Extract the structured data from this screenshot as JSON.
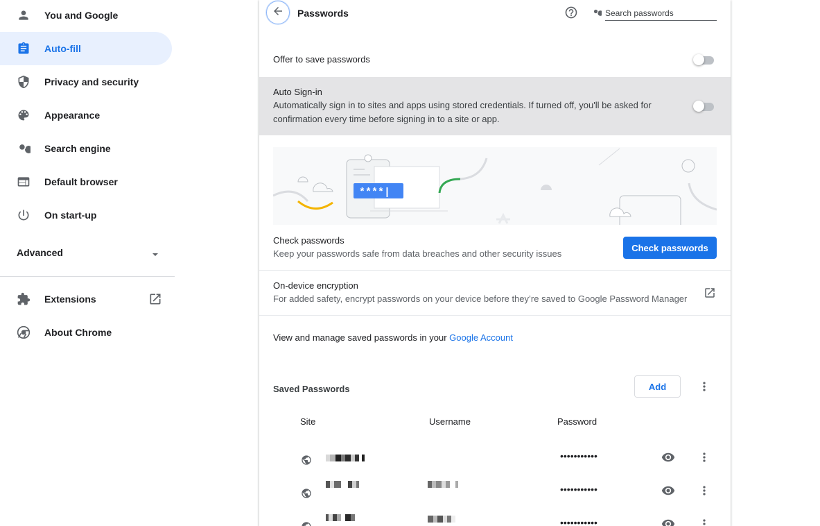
{
  "sidebar": {
    "items": [
      {
        "label": "You and Google",
        "icon": "person-icon"
      },
      {
        "label": "Auto-fill",
        "icon": "assignment-icon",
        "active": true
      },
      {
        "label": "Privacy and security",
        "icon": "shield-icon"
      },
      {
        "label": "Appearance",
        "icon": "palette-icon"
      },
      {
        "label": "Search engine",
        "icon": "search-icon"
      },
      {
        "label": "Default browser",
        "icon": "browser-window-icon"
      },
      {
        "label": "On start-up",
        "icon": "power-icon"
      }
    ],
    "advanced_label": "Advanced",
    "extensions_label": "Extensions",
    "about_label": "About Chrome"
  },
  "header": {
    "title": "Passwords",
    "search_placeholder": "Search passwords"
  },
  "settings": {
    "offer_to_save": {
      "label": "Offer to save passwords",
      "enabled": false
    },
    "auto_signin": {
      "label": "Auto Sign-in",
      "description_line1": "Automatically sign in to sites and apps using stored credentials. If turned off, you'll be asked for",
      "description_line2": "confirmation every time before signing in to a site or app.",
      "enabled": false
    },
    "check_passwords": {
      "label": "Check passwords",
      "description": "Keep your passwords safe from data breaches and other security issues",
      "button_label": "Check passwords"
    },
    "illustration_mask": "****|",
    "on_device_encryption": {
      "label": "On-device encryption",
      "description": "For added safety, encrypt passwords on your device before they’re saved to Google Password Manager"
    },
    "manage_text": "View and manage saved passwords in your",
    "manage_link": "Google Account"
  },
  "saved": {
    "title": "Saved Passwords",
    "add_label": "Add",
    "columns": {
      "site": "Site",
      "username": "Username",
      "password": "Password"
    },
    "rows": [
      {
        "password": "•••••••••••"
      },
      {
        "password": "•••••••••••"
      },
      {
        "password": "•••••••••••"
      }
    ]
  },
  "colors": {
    "accent": "#1a73e8",
    "active_bg": "#e8f0fe",
    "text": "#202124",
    "secondary_text": "#5f6368"
  }
}
